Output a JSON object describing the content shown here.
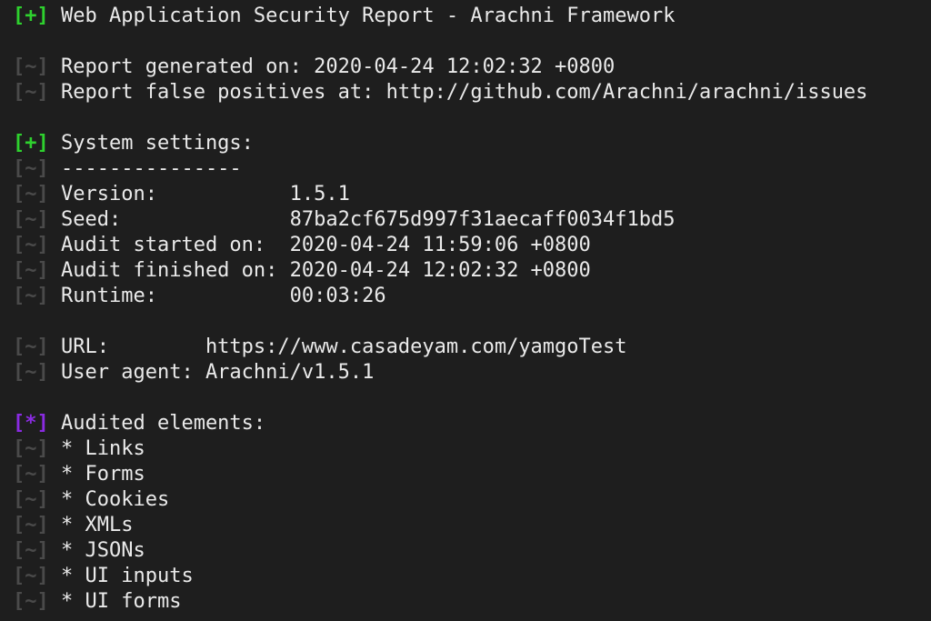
{
  "terminal": {
    "colors": {
      "background": "#1e1e1e",
      "text": "#eaeaea",
      "prefix_ok": "#2ed12e",
      "prefix_info": "#4a4a4a",
      "prefix_star": "#8a2be2"
    },
    "lines": [
      {
        "prefix": "[+]",
        "type": "ok",
        "text": "Web Application Security Report - Arachni Framework"
      },
      {
        "prefix": "",
        "type": "blank",
        "text": ""
      },
      {
        "prefix": "[~]",
        "type": "info",
        "text": "Report generated on: 2020-04-24 12:02:32 +0800"
      },
      {
        "prefix": "[~]",
        "type": "info",
        "text": "Report false positives at: http://github.com/Arachni/arachni/issues"
      },
      {
        "prefix": "",
        "type": "blank",
        "text": ""
      },
      {
        "prefix": "[+]",
        "type": "ok",
        "text": "System settings:"
      },
      {
        "prefix": "[~]",
        "type": "info",
        "text": "---------------"
      },
      {
        "prefix": "[~]",
        "type": "info",
        "text": "Version:           1.5.1"
      },
      {
        "prefix": "[~]",
        "type": "info",
        "text": "Seed:              87ba2cf675d997f31aecaff0034f1bd5"
      },
      {
        "prefix": "[~]",
        "type": "info",
        "text": "Audit started on:  2020-04-24 11:59:06 +0800"
      },
      {
        "prefix": "[~]",
        "type": "info",
        "text": "Audit finished on: 2020-04-24 12:02:32 +0800"
      },
      {
        "prefix": "[~]",
        "type": "info",
        "text": "Runtime:           00:03:26"
      },
      {
        "prefix": "",
        "type": "blank",
        "text": ""
      },
      {
        "prefix": "[~]",
        "type": "info",
        "text": "URL:        https://www.casadeyam.com/yamgoTest"
      },
      {
        "prefix": "[~]",
        "type": "info",
        "text": "User agent: Arachni/v1.5.1"
      },
      {
        "prefix": "",
        "type": "blank",
        "text": ""
      },
      {
        "prefix": "[*]",
        "type": "star",
        "text": "Audited elements:"
      },
      {
        "prefix": "[~]",
        "type": "info",
        "text": "* Links"
      },
      {
        "prefix": "[~]",
        "type": "info",
        "text": "* Forms"
      },
      {
        "prefix": "[~]",
        "type": "info",
        "text": "* Cookies"
      },
      {
        "prefix": "[~]",
        "type": "info",
        "text": "* XMLs"
      },
      {
        "prefix": "[~]",
        "type": "info",
        "text": "* JSONs"
      },
      {
        "prefix": "[~]",
        "type": "info",
        "text": "* UI inputs"
      },
      {
        "prefix": "[~]",
        "type": "info",
        "text": "* UI forms"
      }
    ]
  }
}
